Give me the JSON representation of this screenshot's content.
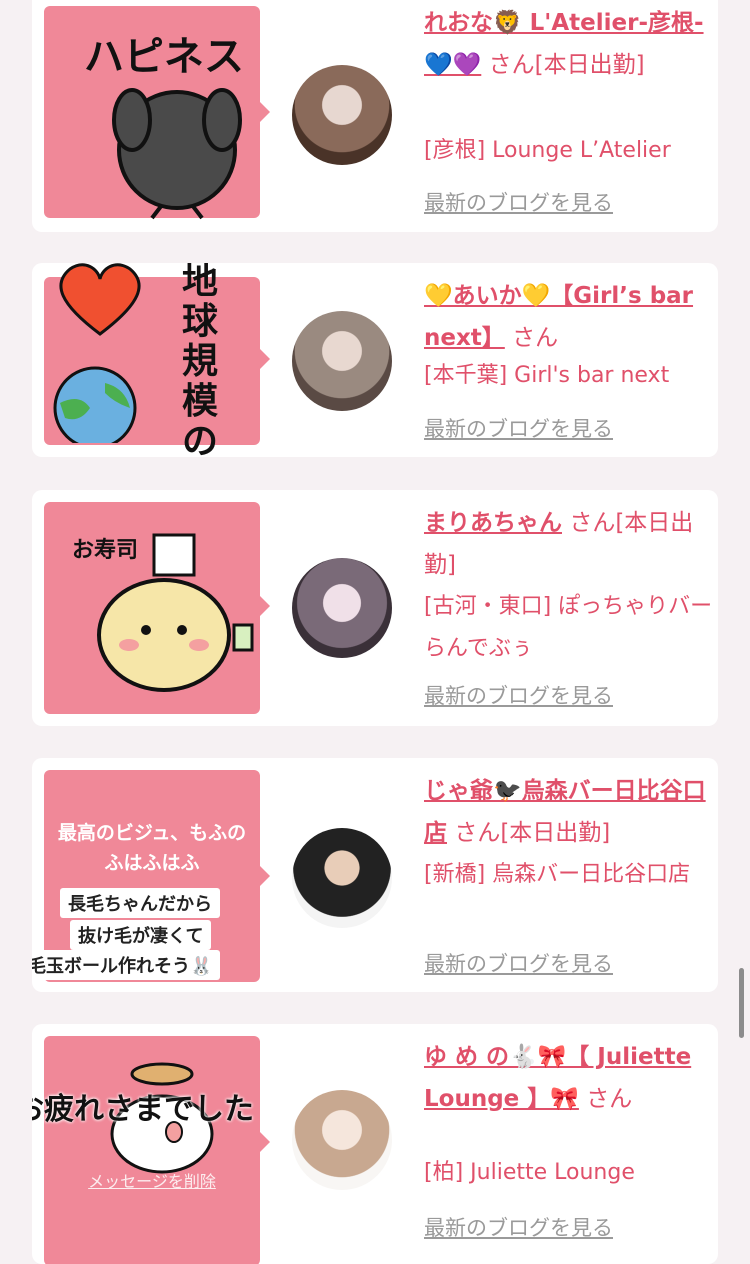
{
  "cards": [
    {
      "name": "れおな🦁 L'Atelier-彦根-💙💜",
      "san": "さん",
      "status": "[本日出勤]",
      "shop": "[彦根] Lounge L’Atelier",
      "blog_link": "最新のブログを見る",
      "bubble_text": "ハピネス"
    },
    {
      "name": "💛あいか💛【Girl’s bar next】",
      "san": "さん",
      "status": "",
      "shop": "[本千葉] Girl's bar next",
      "blog_link": "最新のブログを見る",
      "bubble_text": "地球規模のラブ"
    },
    {
      "name": "まりあちゃん",
      "san": "さん",
      "status": "[本日出勤]",
      "shop": "[古河・東口] ぽっちゃりバー らんでぶぅ",
      "blog_link": "最新のブログを見る",
      "bubble_text": "お寿司"
    },
    {
      "name": "じゃ爺🐦‍⬛烏森バー日比谷口店",
      "san": "さん",
      "status": "[本日出勤]",
      "shop": "[新橋] 烏森バー日比谷口店",
      "blog_link": "最新のブログを見る",
      "bubble_text": "最高のビジュ、もふのふはふはふ",
      "sticker_lines": [
        "長毛ちゃんだから",
        "抜け毛が凄くて",
        "毛玉ボール作れそう🐰"
      ]
    },
    {
      "name": "ゆ め の🐇🎀【 Juliette Lounge 】🎀",
      "san": "さん",
      "status": "",
      "shop": "[柏] Juliette Lounge",
      "blog_link": "最新のブログを見る",
      "bubble_text": "お疲れさまでした",
      "delete_link": "メッセージを削除"
    }
  ]
}
